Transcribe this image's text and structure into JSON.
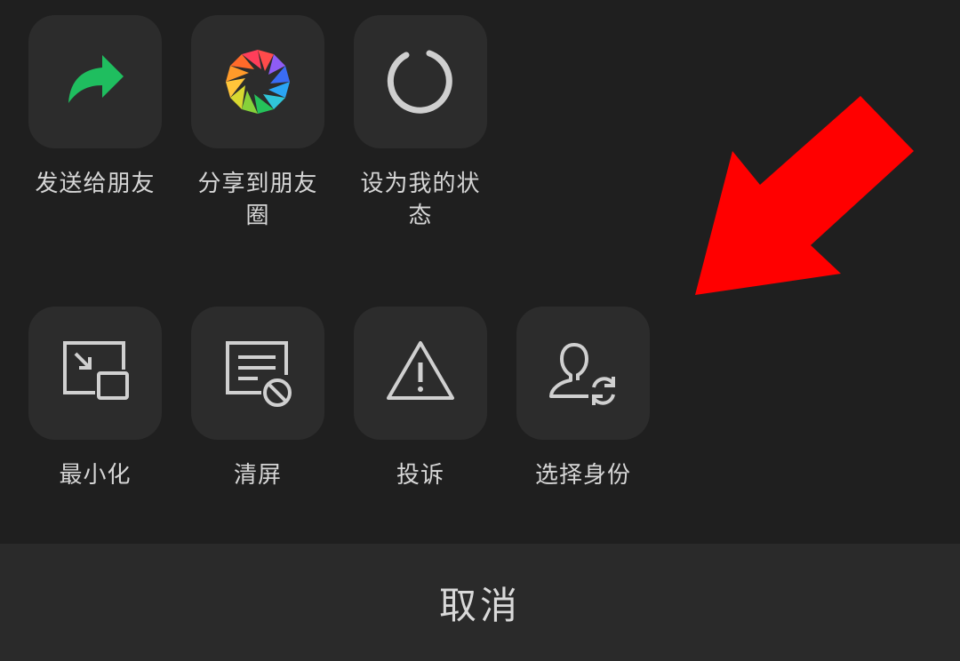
{
  "row1": [
    {
      "label": "发送给朋友",
      "icon": "share-arrow-icon"
    },
    {
      "label": "分享到朋友圈",
      "icon": "moments-aperture-icon"
    },
    {
      "label": "设为我的状态",
      "icon": "status-ring-icon"
    }
  ],
  "row2": [
    {
      "label": "最小化",
      "icon": "minimize-window-icon"
    },
    {
      "label": "清屏",
      "icon": "clear-screen-icon"
    },
    {
      "label": "投诉",
      "icon": "warning-icon"
    },
    {
      "label": "选择身份",
      "icon": "switch-identity-icon"
    }
  ],
  "cancel_label": "取消",
  "colors": {
    "background": "#1f1f1f",
    "tile": "#2c2c2c",
    "share_green": "#1fbe5f",
    "annotation_red": "#ff0000",
    "icon_gray": "#d0d0d0"
  }
}
